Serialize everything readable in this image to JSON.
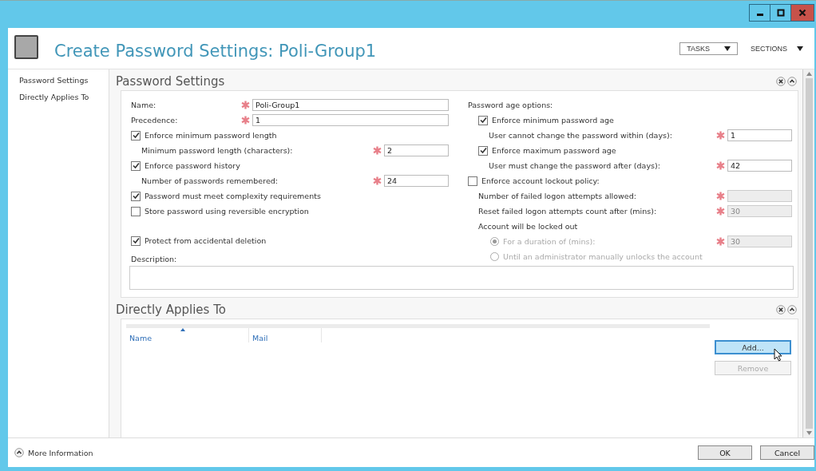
{
  "window": {
    "title": "Create Password Settings: Poli-Group1"
  },
  "toolbar": {
    "tasks": "TASKS",
    "sections": "SECTIONS"
  },
  "sidebar": {
    "items": [
      {
        "label": "Password Settings"
      },
      {
        "label": "Directly Applies To"
      }
    ]
  },
  "password_settings": {
    "title": "Password Settings",
    "left": [
      {
        "kind": "field",
        "label": "Name:",
        "required": true,
        "value": "Poli-Group1",
        "disabled": false
      },
      {
        "kind": "field",
        "label": "Precedence:",
        "required": true,
        "value": "1",
        "disabled": false
      },
      {
        "kind": "check",
        "label": "Enforce minimum password length",
        "checked": true,
        "disabled": false,
        "children": [
          {
            "kind": "field",
            "label": "Minimum password length (characters):",
            "required": true,
            "value": "2",
            "disabled": false
          }
        ]
      },
      {
        "kind": "check",
        "label": "Enforce password history",
        "checked": true,
        "disabled": false,
        "children": [
          {
            "kind": "field",
            "label": "Number of passwords remembered:",
            "required": true,
            "value": "24",
            "disabled": false
          }
        ]
      },
      {
        "kind": "check",
        "label": "Password must meet complexity requirements",
        "checked": true,
        "disabled": false
      },
      {
        "kind": "check",
        "label": "Store password using reversible encryption",
        "checked": false,
        "disabled": false
      }
    ],
    "protect": {
      "label": "Protect from accidental deletion",
      "checked": true
    },
    "description": {
      "label": "Description:"
    },
    "right": [
      {
        "kind": "label",
        "label": "Password age options:",
        "disabled": false,
        "children": [
          {
            "kind": "check",
            "label": "Enforce minimum password age",
            "checked": true,
            "disabled": false,
            "children": [
              {
                "kind": "field",
                "label": "User cannot change the password within (days):",
                "required": true,
                "value": "1",
                "disabled": false
              }
            ]
          },
          {
            "kind": "check",
            "label": "Enforce maximum password age",
            "checked": true,
            "disabled": false,
            "children": [
              {
                "kind": "field",
                "label": "User must change the password after (days):",
                "required": true,
                "value": "42",
                "disabled": false
              }
            ]
          }
        ]
      },
      {
        "kind": "check",
        "label": "Enforce account lockout policy:",
        "checked": false,
        "disabled": false,
        "children": [
          {
            "kind": "field",
            "label": "Number of failed logon attempts allowed:",
            "required": true,
            "disabled": true
          },
          {
            "kind": "field",
            "label": "Reset failed logon attempts count after (mins):",
            "required": true,
            "value": "30",
            "disabled": true
          },
          {
            "kind": "label",
            "label": "Account will be locked out",
            "disabled": false,
            "children": [
              {
                "kind": "radio",
                "label": "For a duration of (mins):",
                "selected": true,
                "disabled": true,
                "field": {
                  "required": true,
                  "value": "30",
                  "disabled": true
                }
              },
              {
                "kind": "radio",
                "label": "Until an administrator manually unlocks the account",
                "selected": false,
                "disabled": true
              }
            ]
          }
        ]
      }
    ]
  },
  "directly_applies_to": {
    "title": "Directly Applies To",
    "columns": [
      {
        "label": "Name",
        "sorted": true
      },
      {
        "label": "Mail",
        "sorted": false
      }
    ],
    "buttons": [
      {
        "label": "Add...",
        "highlighted": true,
        "disabled": false
      },
      {
        "label": "Remove",
        "highlighted": false,
        "disabled": true
      }
    ]
  },
  "footer": {
    "more_info": "More Information",
    "buttons": [
      {
        "label": "OK"
      },
      {
        "label": "Cancel"
      }
    ]
  }
}
